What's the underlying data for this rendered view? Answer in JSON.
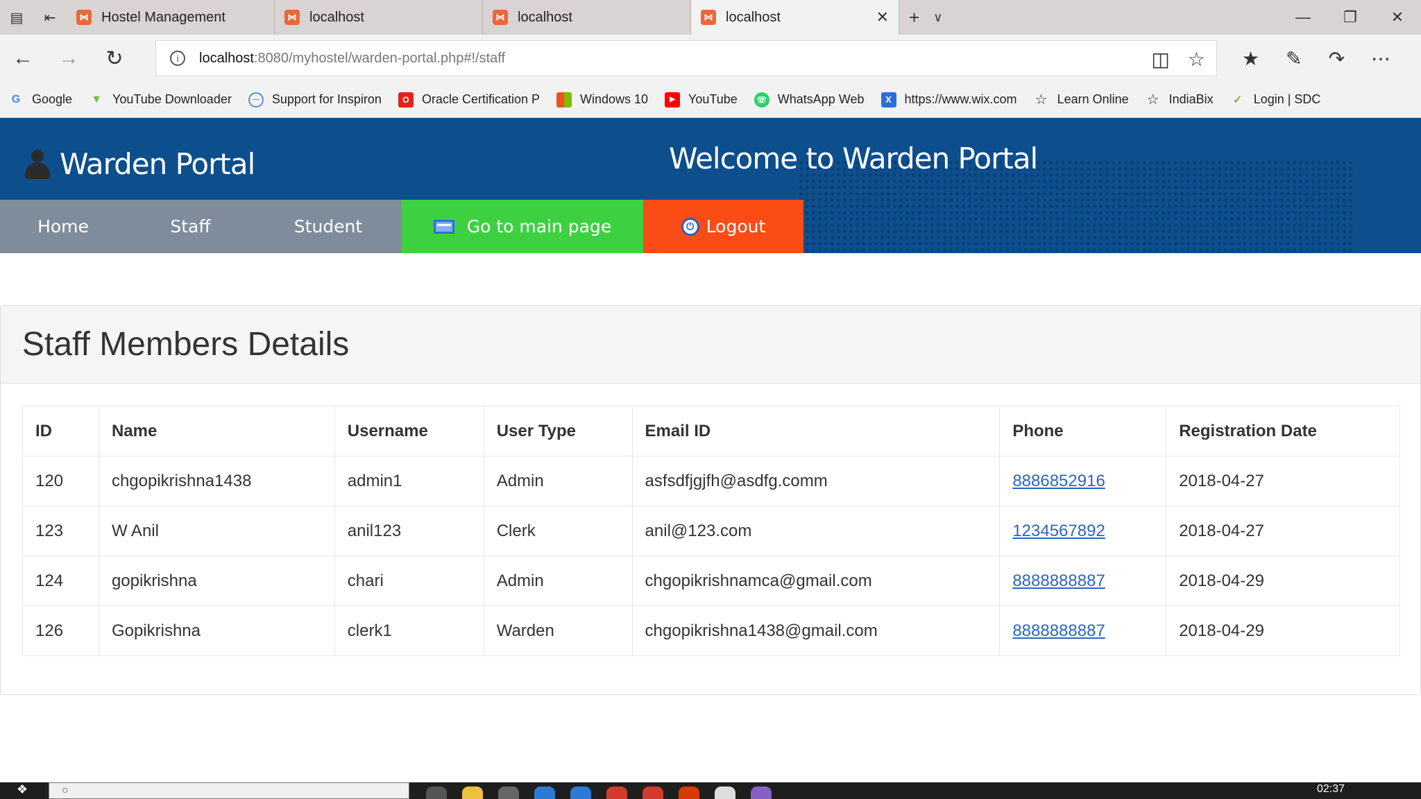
{
  "browser": {
    "tabs": [
      {
        "title": "Hostel Management",
        "active": false
      },
      {
        "title": "localhost",
        "active": false
      },
      {
        "title": "localhost",
        "active": false
      },
      {
        "title": "localhost",
        "active": true
      }
    ],
    "address": {
      "host": "localhost",
      "path": ":8080/myhostel/warden-portal.php#!/staff"
    },
    "favorites": [
      {
        "label": "Google",
        "icon": "google-icon",
        "color": "#4285f4"
      },
      {
        "label": "YouTube Downloader",
        "icon": "download-icon",
        "color": "#6cc04a"
      },
      {
        "label": "Support for Inspiron",
        "icon": "dell-icon",
        "color": "#5a8fd0"
      },
      {
        "label": "Oracle Certification P",
        "icon": "oracle-icon",
        "color": "#e2231a"
      },
      {
        "label": "Windows 10",
        "icon": "windows-icon",
        "color": "#f25022"
      },
      {
        "label": "YouTube",
        "icon": "youtube-icon",
        "color": "#ff0000"
      },
      {
        "label": "WhatsApp Web",
        "icon": "whatsapp-icon",
        "color": "#25d366"
      },
      {
        "label": "https://www.wix.com",
        "icon": "wix-icon",
        "color": "#2b6fd6"
      },
      {
        "label": "Learn Online",
        "icon": "star-icon",
        "color": "#333333"
      },
      {
        "label": "IndiaBix",
        "icon": "star-icon",
        "color": "#333333"
      },
      {
        "label": "Login | SDC",
        "icon": "sdc-icon",
        "color": "#7ab648"
      }
    ]
  },
  "header": {
    "brand": "Warden Portal",
    "welcome": "Welcome to Warden Portal",
    "background_color": "#0d4e8d"
  },
  "menu": {
    "home": "Home",
    "staff": "Staff",
    "student": "Student",
    "main_page": "Go to main page",
    "logout": "Logout"
  },
  "panel": {
    "title": "Staff Members Details"
  },
  "table": {
    "headers": [
      "ID",
      "Name",
      "Username",
      "User Type",
      "Email ID",
      "Phone",
      "Registration Date"
    ],
    "rows": [
      {
        "id": "120",
        "name": "chgopikrishna1438",
        "username": "admin1",
        "user_type": "Admin",
        "email": "asfsdfjgjfh@asdfg.comm",
        "phone": "8886852916",
        "date": "2018-04-27"
      },
      {
        "id": "123",
        "name": "W Anil",
        "username": "anil123",
        "user_type": "Clerk",
        "email": "anil@123.com",
        "phone": "1234567892",
        "date": "2018-04-27"
      },
      {
        "id": "124",
        "name": "gopikrishna",
        "username": "chari",
        "user_type": "Admin",
        "email": "chgopikrishnamca@gmail.com",
        "phone": "8888888887",
        "date": "2018-04-29"
      },
      {
        "id": "126",
        "name": "Gopikrishna",
        "username": "clerk1",
        "user_type": "Warden",
        "email": "chgopikrishna1438@gmail.com",
        "phone": "8888888887",
        "date": "2018-04-29"
      }
    ]
  },
  "taskbar": {
    "clock": "02:37"
  }
}
